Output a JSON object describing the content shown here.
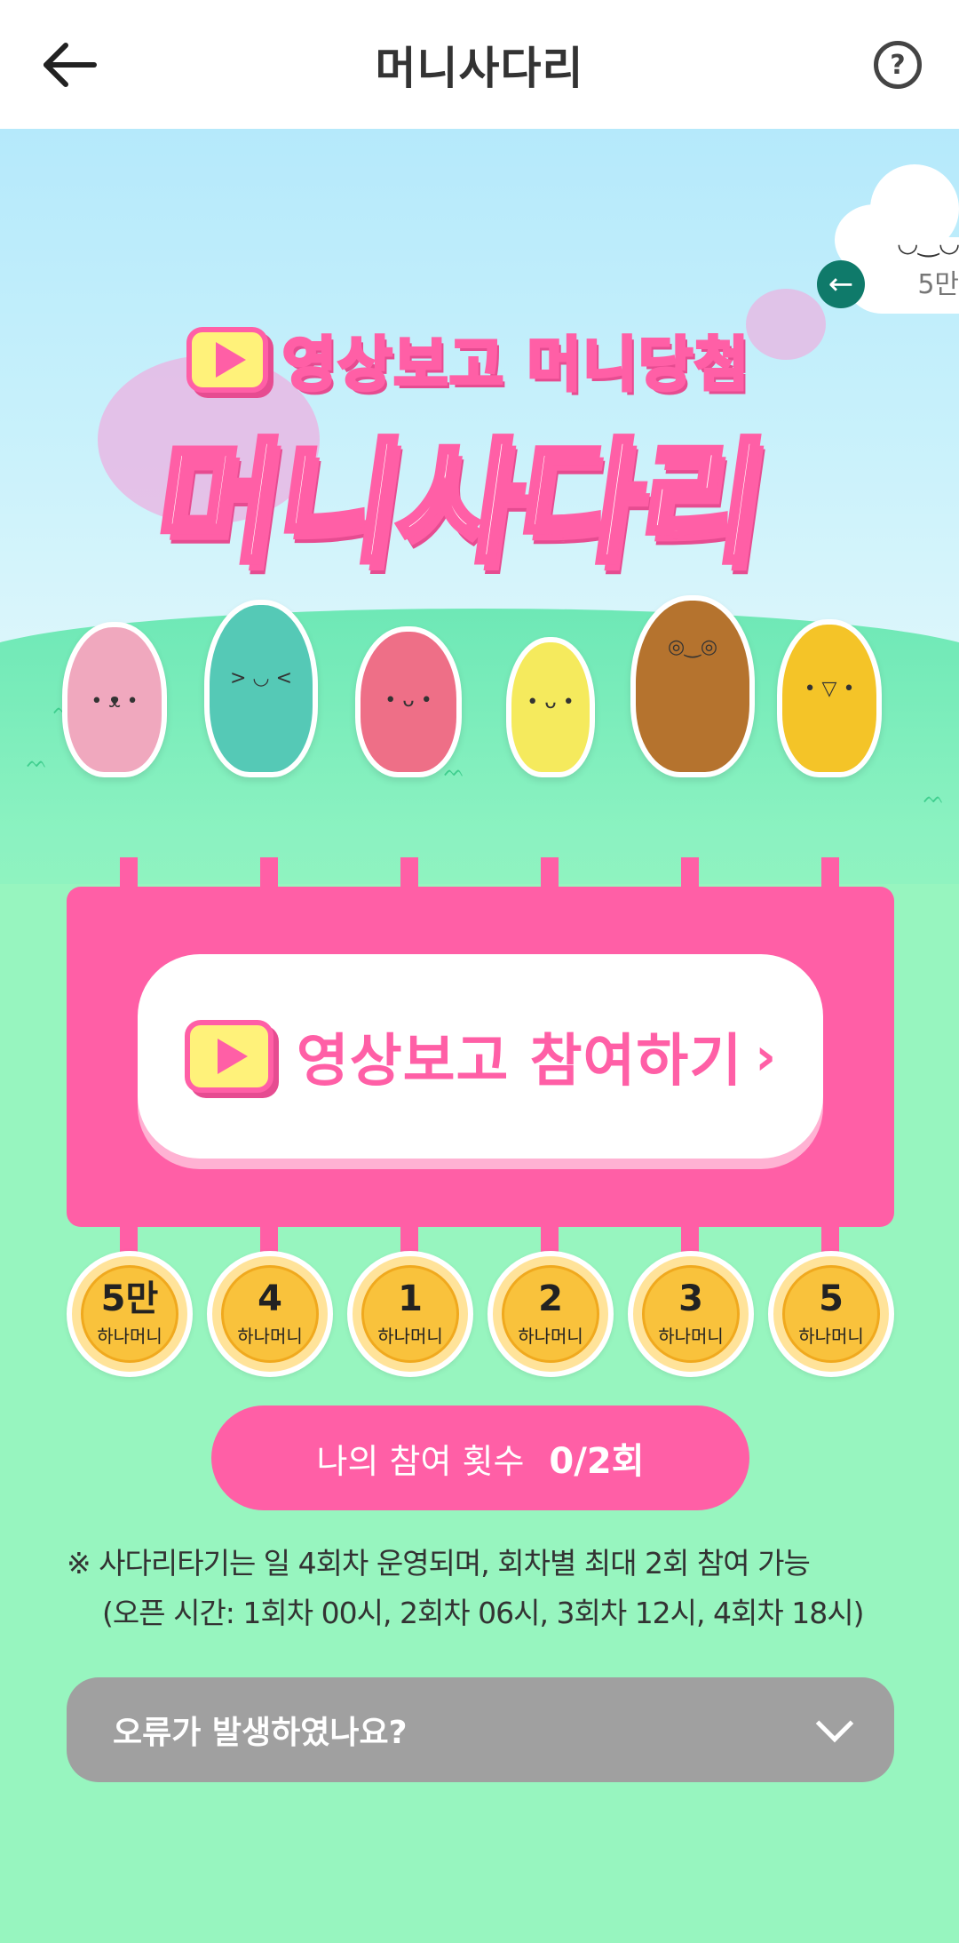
{
  "header": {
    "title": "머니사다리",
    "back_icon": "arrow-left-icon",
    "help_icon": "question-circle-icon"
  },
  "hero": {
    "subtitle": "영상보고 머니당첨",
    "main_title": "머니사다리",
    "cloud_reward": "5만",
    "characters": [
      {
        "color": "#f0a8be"
      },
      {
        "color": "#55c9b6"
      },
      {
        "color": "#ee6f87"
      },
      {
        "color": "#f5ea5d"
      },
      {
        "color": "#b5732e"
      },
      {
        "color": "#f4c428"
      }
    ]
  },
  "cta": {
    "label": "영상보고 참여하기",
    "chevron": "›"
  },
  "medals": [
    {
      "amount": "5만",
      "unit": "하나머니"
    },
    {
      "amount": "4",
      "unit": "하나머니"
    },
    {
      "amount": "1",
      "unit": "하나머니"
    },
    {
      "amount": "2",
      "unit": "하나머니"
    },
    {
      "amount": "3",
      "unit": "하나머니"
    },
    {
      "amount": "5",
      "unit": "하나머니"
    }
  ],
  "participation": {
    "label": "나의 참여 횟수",
    "value": "0/2회"
  },
  "notice": {
    "line1": "※ 사다리타기는 일 4회차 운영되며, 회차별 최대 2회 참여 가능",
    "line2": "(오픈 시간: 1회차 00시, 2회차 06시, 3회차 12시, 4회차 18시)"
  },
  "error": {
    "label": "오류가 발생하였나요?"
  },
  "colors": {
    "pink": "#ff5fa6",
    "mint": "#97f5bf",
    "gray": "#a0a0a0",
    "gold": "#f9c23c"
  }
}
